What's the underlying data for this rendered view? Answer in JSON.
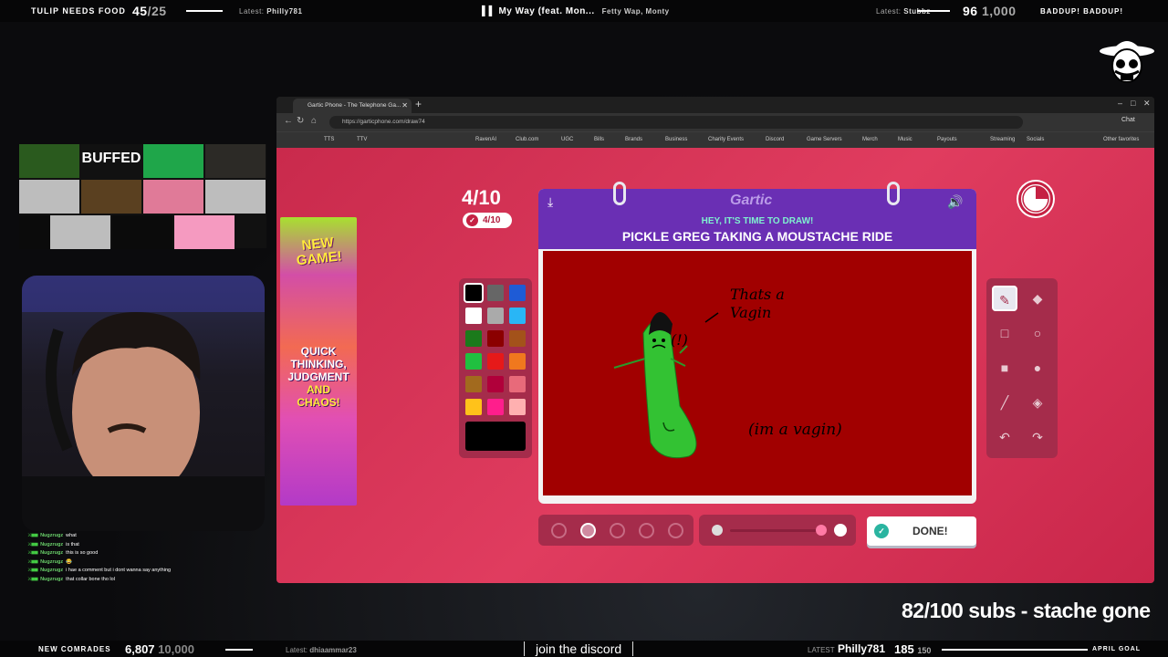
{
  "top_bar": {
    "title": "TULIP NEEDS FOOD",
    "count": "45",
    "count_goal": "/25",
    "latest_label": "Latest:",
    "latest_name": "Philly781",
    "song_title": "My Way (feat. Mon...",
    "song_artist": "Fetty Wap, Monty",
    "latest2_label": "Latest:",
    "latest2_name": "Stubbz",
    "right_count": "96",
    "right_goal": "1,000",
    "right_title": "BADDUP! BADDUP!"
  },
  "bottom_bar": {
    "label": "NEW COMRADES",
    "count": "6,807",
    "goal": "10,000",
    "latest_label": "Latest:",
    "latest_name": "dhiaammar23",
    "join_text": "join the discord",
    "latest2_label": "LATEST",
    "latest2_name": "Philly781",
    "sub_count": "185",
    "sub_goal": "150",
    "goal_label": "APRIL GOAL"
  },
  "subs_overlay": "82/100 subs - stache gone",
  "chat": {
    "messages": [
      {
        "user": "Nugzrugz",
        "text": "what"
      },
      {
        "user": "Nugzrugz",
        "text": "is that"
      },
      {
        "user": "Nugzrugz",
        "text": "this is so good"
      },
      {
        "user": "Nugzrugz",
        "text": "😂"
      },
      {
        "user": "Nugzrugz",
        "text": "i hae a comment but i dont wanna say anything"
      },
      {
        "user": "Nugzrugz",
        "text": "that collar bone tho lol"
      }
    ]
  },
  "grid_tiles": [
    {
      "label": "",
      "color": "#2a5a1e"
    },
    {
      "label": "BUFFED",
      "color": "#111111"
    },
    {
      "label": "",
      "color": "#1fa64a"
    },
    {
      "label": "",
      "color": "#2c2a26"
    },
    {
      "label": "",
      "color": "#bdbdbd"
    },
    {
      "label": "",
      "color": "#5a4020"
    },
    {
      "label": "",
      "color": "#e07a98"
    },
    {
      "label": "",
      "color": "#bdbdbd"
    },
    {
      "label": "",
      "color": "#0b0b0b"
    },
    {
      "label": "",
      "color": "#bdbdbd"
    },
    {
      "label": "",
      "color": "#0b0b0b"
    },
    {
      "label": "",
      "color": "#f59ac0"
    }
  ],
  "ad": {
    "line1": "NEW GAME!",
    "line2a": "QUICK THINKING, JUDGMENT",
    "line2b": "AND CHAOS!"
  },
  "browser": {
    "tab_title": "Gartic Phone - The Telephone Ga...",
    "url": "https://garticphone.com/draw74",
    "chat_label": "Chat",
    "bookmarks": [
      "TTS",
      "TTV",
      "RavenAI",
      "Club.com",
      "UGC",
      "Bills",
      "Brands",
      "Business",
      "Charity Events",
      "Discord",
      "Game Servers",
      "Merch",
      "Music",
      "Payouts",
      "Streaming",
      "Socials",
      "Other favorites"
    ]
  },
  "game": {
    "round": "4/10",
    "round_pill": "4/10",
    "logo": "Gartic",
    "subtitle": "HEY, IT'S TIME TO DRAW!",
    "prompt": "PICKLE GREG TAKING A MOUSTACHE RIDE",
    "done_label": "DONE!",
    "drawing_text_1": "Thats a Vagin",
    "drawing_text_2": "(im a vagin)",
    "drawing_text_3": "(!)",
    "palette": [
      "#000000",
      "#666666",
      "#1e5bd6",
      "#ffffff",
      "#aaaaaa",
      "#29b6f6",
      "#1b7a1b",
      "#8b0000",
      "#a3521a",
      "#20c040",
      "#e61919",
      "#f0781e",
      "#a26a1e",
      "#b0003a",
      "#e86a7a",
      "#ffc21a",
      "#ff1e8c",
      "#ffb0b0"
    ],
    "selected_color": "#000000",
    "brush_sizes": 5,
    "selected_brush_index": 1,
    "tools": [
      "pencil-icon",
      "eraser-icon",
      "rect-outline-icon",
      "circle-outline-icon",
      "rect-fill-icon",
      "circle-fill-icon",
      "line-icon",
      "fill-bucket-icon",
      "undo-icon",
      "redo-icon"
    ],
    "active_tool_index": 0
  }
}
